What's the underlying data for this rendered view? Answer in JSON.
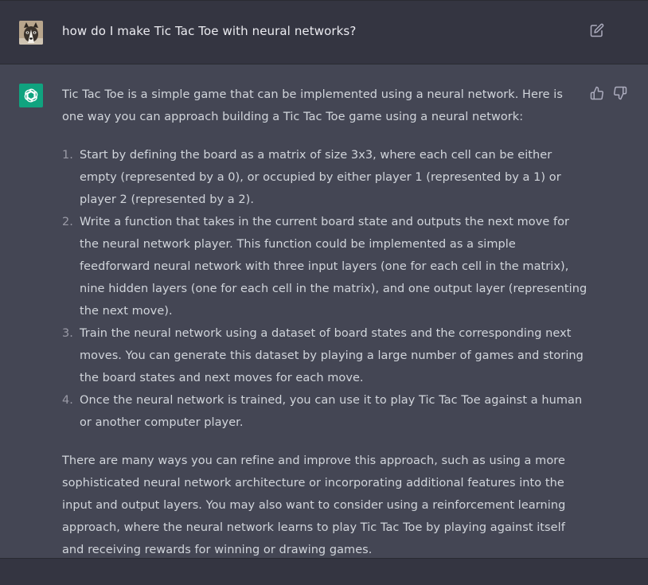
{
  "user_message": {
    "text": "how do I make Tic Tac Toe with neural networks?",
    "edit_icon": "edit-icon"
  },
  "assistant_message": {
    "avatar_icon": "openai-logo-icon",
    "feedback": {
      "thumbs_up_icon": "thumbs-up-icon",
      "thumbs_down_icon": "thumbs-down-icon"
    },
    "intro": "Tic Tac Toe is a simple game that can be implemented using a neural network. Here is one way you can approach building a Tic Tac Toe game using a neural network:",
    "steps": [
      {
        "num": "1.",
        "text": "Start by defining the board as a matrix of size 3x3, where each cell can be either empty (represented by a 0), or occupied by either player 1 (represented by a 1) or player 2 (represented by a 2)."
      },
      {
        "num": "2.",
        "text": "Write a function that takes in the current board state and outputs the next move for the neural network player. This function could be implemented as a simple feedforward neural network with three input layers (one for each cell in the matrix), nine hidden layers (one for each cell in the matrix), and one output layer (representing the next move)."
      },
      {
        "num": "3.",
        "text": "Train the neural network using a dataset of board states and the corresponding next moves. You can generate this dataset by playing a large number of games and storing the board states and next moves for each move."
      },
      {
        "num": "4.",
        "text": "Once the neural network is trained, you can use it to play Tic Tac Toe against a human or another computer player."
      }
    ],
    "conclusion": "There are many ways you can refine and improve this approach, such as using a more sophisticated neural network architecture or incorporating additional features into the input and output layers. You may also want to consider using a reinforcement learning approach, where the neural network learns to play Tic Tac Toe by playing against itself and receiving rewards for winning or drawing games."
  },
  "colors": {
    "background": "#343541",
    "assistant_background": "#444654",
    "accent": "#10a37f",
    "text": "#d1d5db"
  }
}
